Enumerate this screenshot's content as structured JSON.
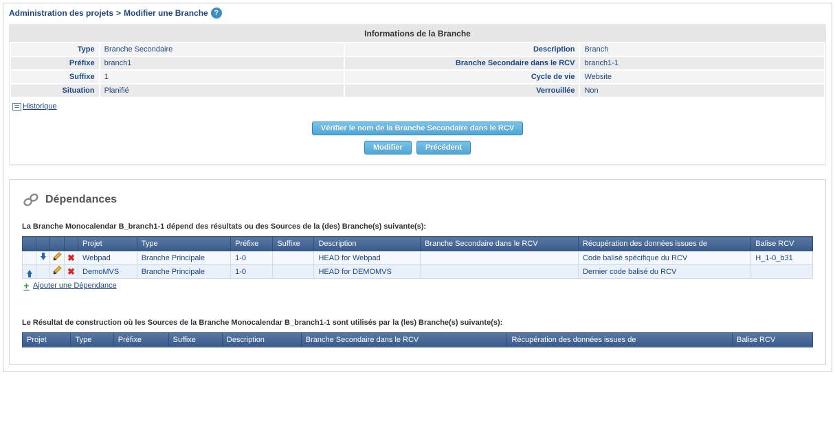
{
  "breadcrumb": {
    "part1": "Administration des projets",
    "sep": ">",
    "part2": "Modifier une Branche"
  },
  "panel_title": "Informations de la Branche",
  "info": {
    "type_label": "Type",
    "type_value": "Branche Secondaire",
    "desc_label": "Description",
    "desc_value": "Branch",
    "prefix_label": "Préfixe",
    "prefix_value": "branch1",
    "rcv_label": "Branche Secondaire dans le RCV",
    "rcv_value": "branch1-1",
    "suffix_label": "Suffixe",
    "suffix_value": "1",
    "lifecycle_label": "Cycle de vie",
    "lifecycle_value": "Website",
    "status_label": "Situation",
    "status_value": "Planifié",
    "locked_label": "Verrouillée",
    "locked_value": "Non"
  },
  "history_link": "Historique",
  "buttons": {
    "verify": "Vérifier le nom de la Branche Secondaire dans le RCV",
    "modify": "Modifier",
    "previous": "Précédent"
  },
  "dependencies": {
    "title": "Dépendances",
    "intro1": "La Branche Monocalendar B_branch1-1 dépend des résultats ou des Sources de la (des) Branche(s) suivante(s):",
    "columns": {
      "project": "Projet",
      "type": "Type",
      "prefix": "Préfixe",
      "suffix": "Suffixe",
      "description": "Description",
      "rcv": "Branche Secondaire dans le RCV",
      "retrieval": "Récupération des données issues de",
      "tag": "Balise RCV"
    },
    "rows": [
      {
        "project": "Webpad",
        "type": "Branche Principale",
        "prefix": "1-0",
        "suffix": "",
        "description": "HEAD for Webpad",
        "rcv": "",
        "retrieval": "Code balisé spécifique du RCV",
        "tag": "H_1-0_b31"
      },
      {
        "project": "DemoMVS",
        "type": "Branche Principale",
        "prefix": "1-0",
        "suffix": "",
        "description": "HEAD for DEMOMVS",
        "rcv": "",
        "retrieval": "Dernier code balisé du RCV",
        "tag": ""
      }
    ],
    "add_link": "Ajouter une Dépendance",
    "intro2": "Le Résultat de construction où les Sources de la Branche Monocalendar B_branch1-1 sont utilisés par la (les) Branche(s) suivante(s):"
  }
}
